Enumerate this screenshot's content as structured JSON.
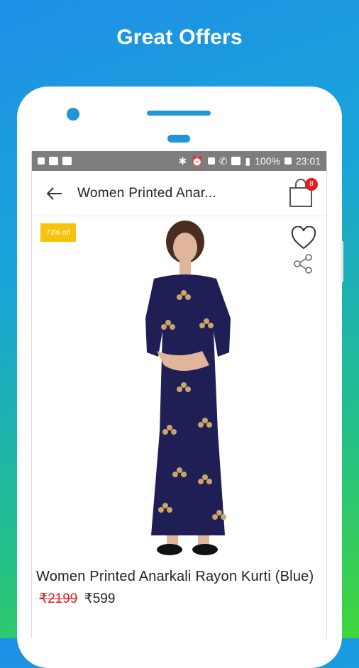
{
  "promo": {
    "title": "Great Offers"
  },
  "statusbar": {
    "left_icons": [
      "sim-icon",
      "message-icon",
      "image-icon"
    ],
    "right_icons": [
      "bluetooth-icon",
      "alarm-icon",
      "volte-icon",
      "call-icon",
      "lte-signal-icon",
      "wifi-signal-icon"
    ],
    "battery": "100%",
    "time": "23:01"
  },
  "appbar": {
    "back_icon": "arrow-left-icon",
    "title": "Women Printed Anar...",
    "cart_icon": "shopping-bag-icon",
    "cart_count": "8"
  },
  "product": {
    "discount_label": "73% off",
    "wishlist_icon": "heart-icon",
    "share_icon": "share-icon",
    "name": "Women Printed Anarkali Rayon Kurti (Blue)",
    "mrp": "₹2199",
    "price": "₹599"
  },
  "colors": {
    "accent": "#2196d6",
    "badge": "#f7c20b",
    "cart_badge": "#e02020",
    "statusbar": "#7d7d7d"
  }
}
